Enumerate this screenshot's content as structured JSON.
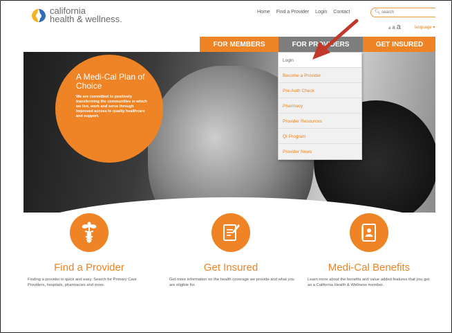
{
  "header": {
    "logo_line1": "california",
    "logo_line2": "health & wellness.",
    "topnav": [
      "Home",
      "Find a Provider",
      "Login",
      "Contact"
    ],
    "search_placeholder": "search",
    "fontsize": {
      "small": "a",
      "medium": "a",
      "large": "a"
    },
    "language_label": "language ▾"
  },
  "mainnav": {
    "members": "FOR MEMBERS",
    "providers": "FOR PROVIDERS",
    "insured": "GET INSURED"
  },
  "dropdown": {
    "items": [
      "Login",
      "Become a Provider",
      "Pre-Auth Check",
      "Pharmacy",
      "Provider Resources",
      "QI Program",
      "Provider News"
    ]
  },
  "hero": {
    "title": "A Medi-Cal Plan of Choice",
    "text": "We are committed to positively transforming the communities in which we live, work and serve through improved access to quality healthcare and support."
  },
  "features": [
    {
      "title": "Find a Provider",
      "icon": "caduceus-icon",
      "text": "Finding a provider is quick and easy. Search for Primary Care Providers, hospitals, pharmacies and more."
    },
    {
      "title": "Get Insured",
      "icon": "document-pencil-icon",
      "text": "Get more information on the health coverage we provide and what you are eligible for."
    },
    {
      "title": "Medi-Cal Benefits",
      "icon": "id-card-icon",
      "text": "Learn more about the benefits and value added features that you get as a California Health & Wellness member."
    }
  ],
  "colors": {
    "accent": "#ee8426",
    "nav_gray": "#7d7d7d",
    "arrow": "#c0392b"
  }
}
